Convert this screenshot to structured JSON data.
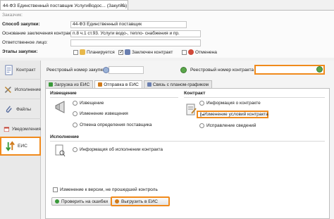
{
  "window": {
    "tab_title": "44-ФЗ Единственный поставщик УслугиВодос... (Закупка)",
    "close": "✕"
  },
  "header": {
    "purchaser_label": "Заказчик:",
    "method_label": "Способ закупки:",
    "method_value": "44-ФЗ Единственный поставщик",
    "basis_label": "Основание заключения контракта:",
    "basis_value": "п.8 ч.1 ст.93. Услуги водо-, тепло- снабжения и пр.",
    "responsible_label": "Ответственное лицо:",
    "responsible_value": "",
    "stages_label": "Этапы закупки:",
    "stages": [
      {
        "label": "Планируется",
        "checked": false,
        "color": "#e8b84a"
      },
      {
        "label": "Заключен контракт",
        "checked": true,
        "color": "#6a7fb0"
      },
      {
        "label": "Отменена",
        "checked": false,
        "color": "#d04a3a"
      }
    ]
  },
  "sidebar": {
    "items": [
      {
        "label": "Контракт",
        "icon": "contract-icon"
      },
      {
        "label": "Исполнение",
        "icon": "tools-icon"
      },
      {
        "label": "Файлы",
        "icon": "paperclip-icon"
      },
      {
        "label": "Уведомления",
        "icon": "calendar-icon"
      },
      {
        "label": "ЕИС",
        "icon": "sync-arrows-icon",
        "active": true
      }
    ]
  },
  "registry": {
    "purchase_label": "Реестровый номер закупки",
    "purchase_value": "",
    "contract_label": "Реестровый номер контракта",
    "contract_value": ""
  },
  "tabs": [
    {
      "label": "Загрузка из ЕИС",
      "selected": false
    },
    {
      "label": "Отправка в ЕИС",
      "selected": true
    },
    {
      "label": "Связь с планом-графиком",
      "selected": false
    }
  ],
  "notice": {
    "title": "Извещение",
    "options": [
      {
        "label": "Извещение",
        "checked": false
      },
      {
        "label": "Изменение извещения",
        "checked": false
      },
      {
        "label": "Отмена определения поставщика",
        "checked": false
      }
    ]
  },
  "contract": {
    "title": "Контракт",
    "options": [
      {
        "label": "Информация о контракте",
        "checked": false
      },
      {
        "label": "Изменение условий контракта",
        "checked": true
      },
      {
        "label": "Исправление сведений",
        "checked": false
      }
    ]
  },
  "execution": {
    "title": "Исполнение",
    "options": [
      {
        "label": "Информация об исполнении контракта",
        "checked": false
      }
    ]
  },
  "footer": {
    "checkbox_label": "Изменение к версии, не прошедшей контроль",
    "check_button": "Проверить на ошибки",
    "upload_button": "Выгрузить в ЕИС"
  }
}
